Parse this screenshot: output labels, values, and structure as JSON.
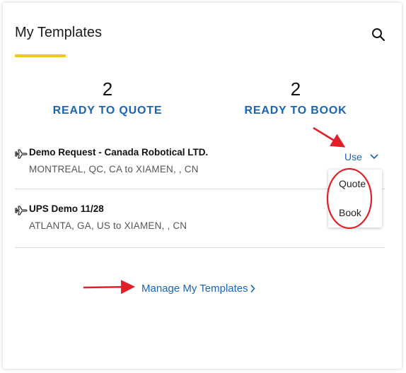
{
  "header": {
    "title": "My Templates"
  },
  "stats": {
    "quote": {
      "count": "2",
      "label": "READY TO QUOTE"
    },
    "book": {
      "count": "2",
      "label": "READY TO BOOK"
    }
  },
  "templates": [
    {
      "name": "Demo Request - Canada Robotical LTD.",
      "route": "MONTREAL, QC, CA to XIAMEN, , CN"
    },
    {
      "name": "UPS Demo 11/28",
      "route": "ATLANTA, GA, US to XIAMEN, , CN"
    }
  ],
  "use_button": {
    "label": "Use"
  },
  "use_menu": {
    "items": [
      "Quote",
      "Book"
    ]
  },
  "manage_link": {
    "label": "Manage My Templates"
  },
  "colors": {
    "accent_blue": "#1a64b4",
    "underline_yellow": "#f5c518",
    "annotation_red": "#e01f26"
  }
}
